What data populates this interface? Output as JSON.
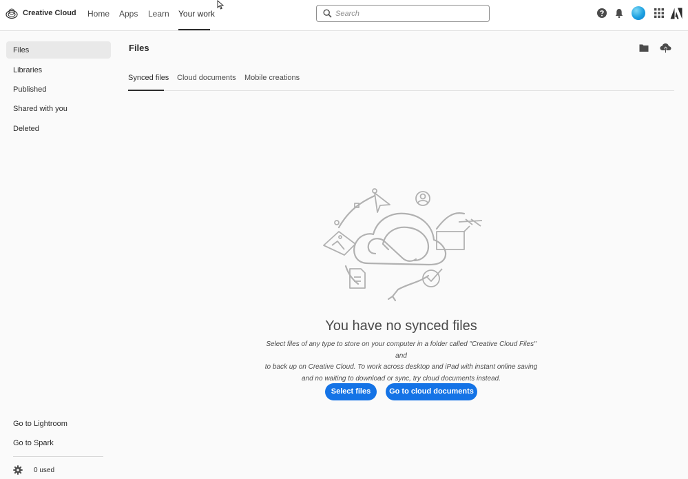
{
  "header": {
    "brand": "Creative Cloud",
    "nav": [
      "Home",
      "Apps",
      "Learn",
      "Your work"
    ],
    "active_nav": "Your work",
    "search_placeholder": "Search",
    "icons": [
      "help-icon",
      "bell-icon",
      "avatar",
      "apps-grid-icon",
      "adobe-logo-icon"
    ],
    "colors": {
      "accent": "#1473e6",
      "avatar": "#1ca0e0"
    }
  },
  "sidebar": {
    "items": [
      "Files",
      "Libraries",
      "Published",
      "Shared with you",
      "Deleted"
    ],
    "active_item": "Files",
    "bottom_links": [
      "Go to Lightroom",
      "Go to Spark"
    ],
    "usage": "0 used"
  },
  "main": {
    "title": "Files",
    "tabs": [
      "Synced files",
      "Cloud documents",
      "Mobile creations"
    ],
    "active_tab": "Synced files",
    "header_icons": [
      "folder-icon",
      "cloud-upload-icon"
    ],
    "empty_state": {
      "title": "You have no synced files",
      "desc_line1": "Select files of any type to store on your computer in a folder called \"Creative Cloud Files\" and",
      "desc_line2": "to back up on Creative Cloud. To work across desktop and iPad with instant online saving",
      "desc_line3": "and no waiting to download or sync, try cloud documents instead.",
      "primary_button": "Select files",
      "secondary_button": "Go to cloud documents"
    }
  }
}
